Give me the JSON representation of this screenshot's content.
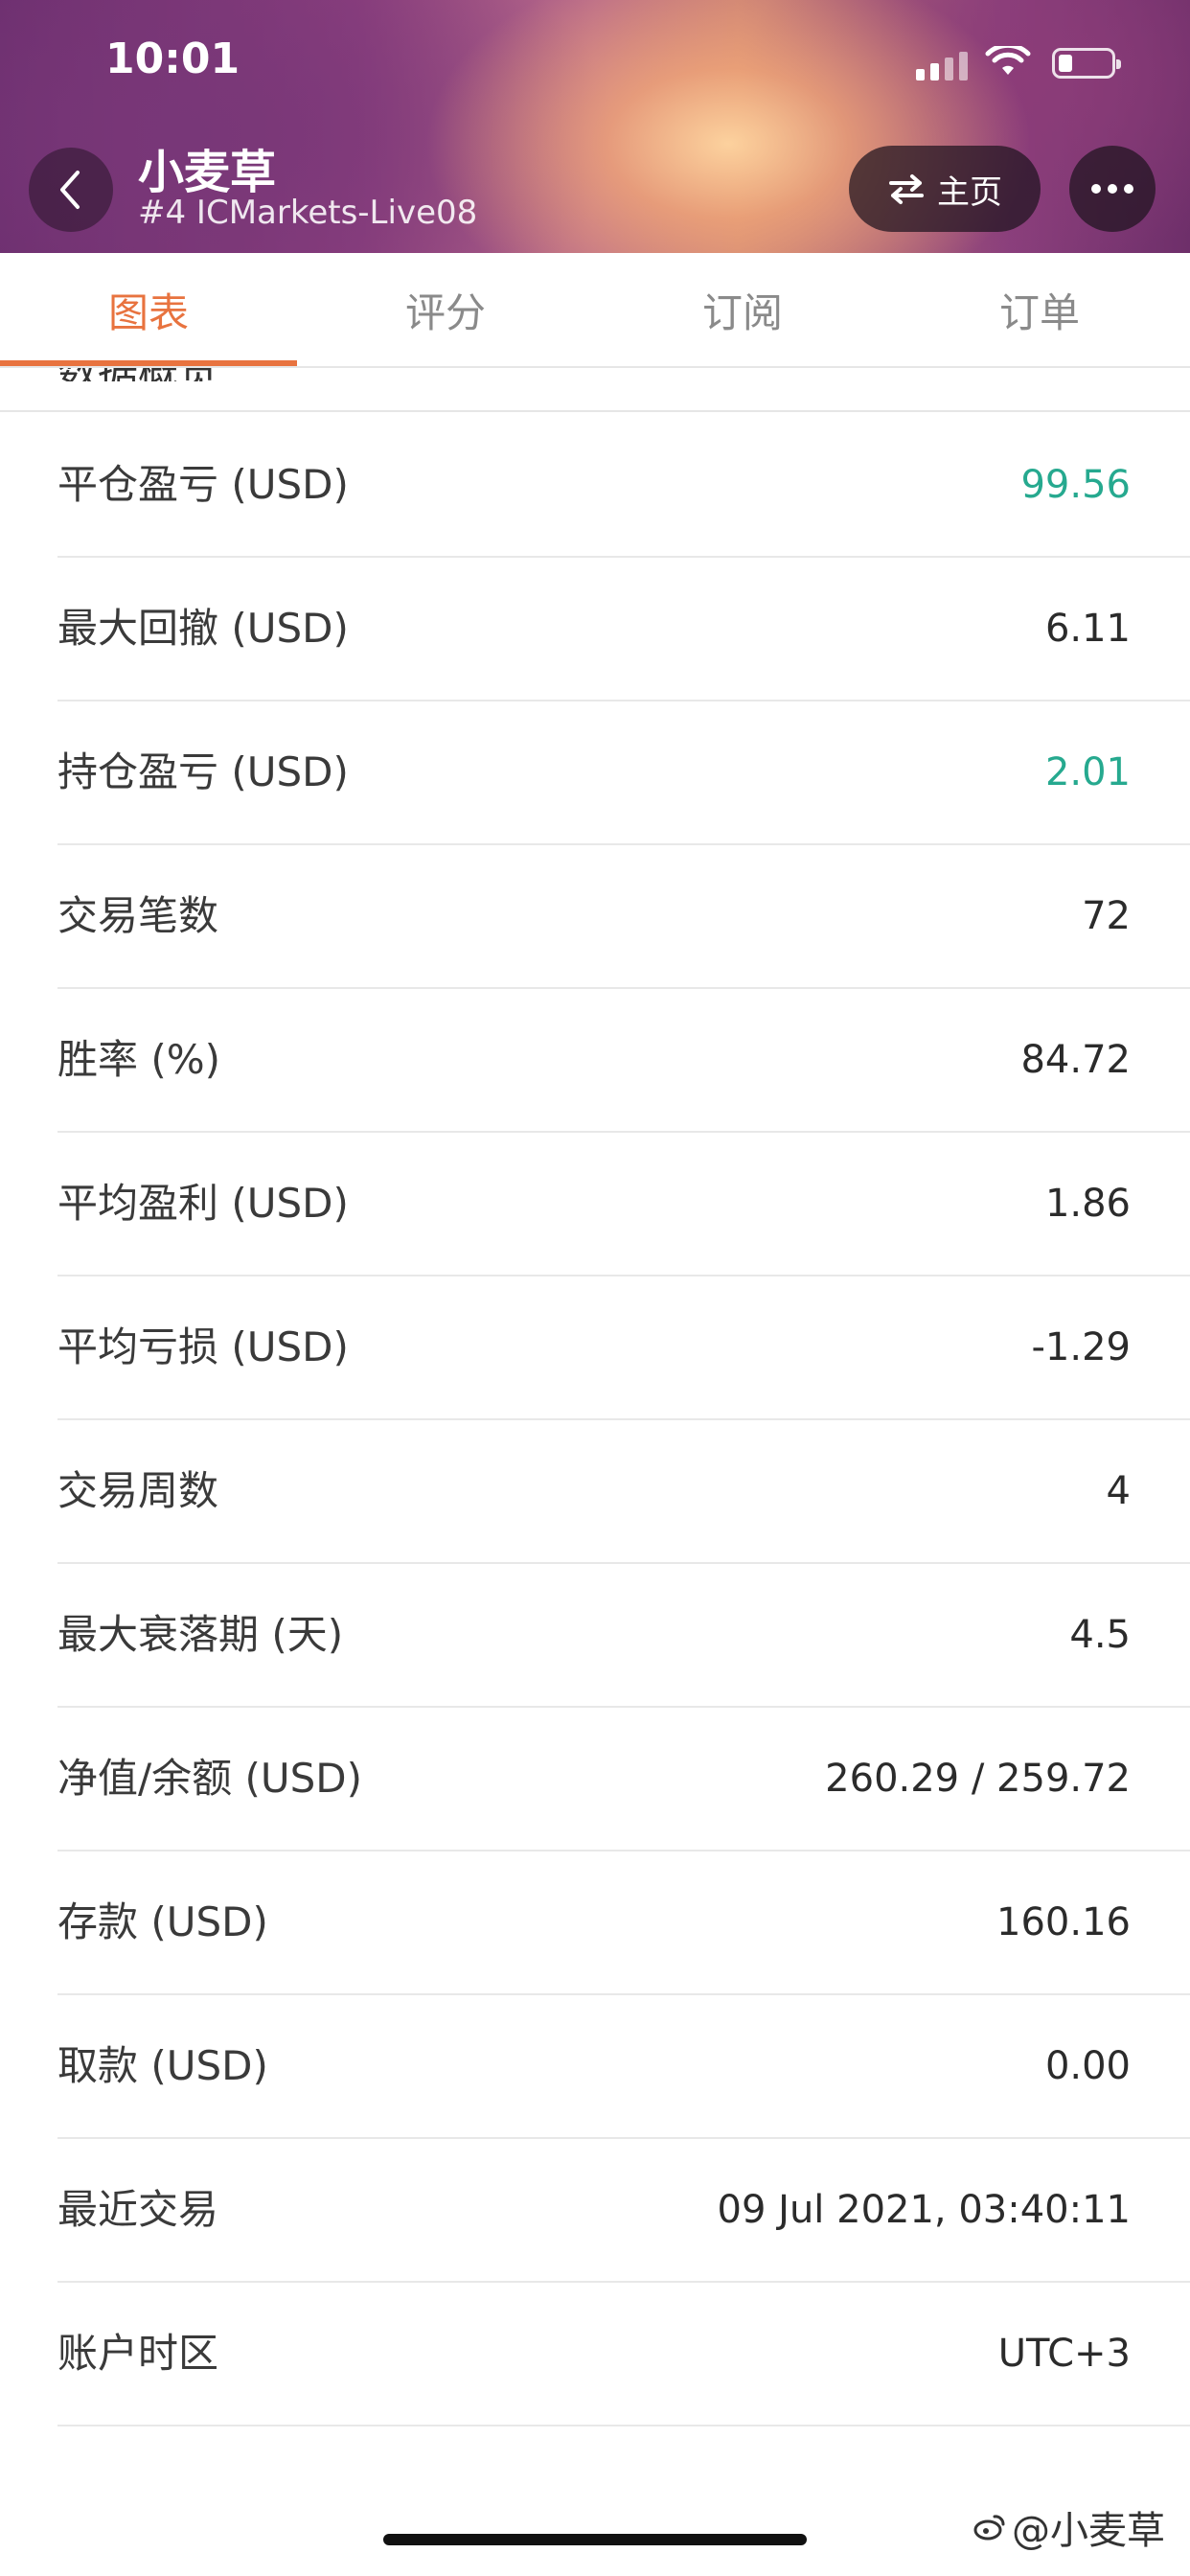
{
  "status_bar": {
    "time": "10:01"
  },
  "header": {
    "title": "小麦草",
    "subtitle": "#4 ICMarkets-Live08",
    "home_label": "主页"
  },
  "tabs": [
    {
      "label": "图表",
      "active": true
    },
    {
      "label": "评分",
      "active": false
    },
    {
      "label": "订阅",
      "active": false
    },
    {
      "label": "订单",
      "active": false
    }
  ],
  "section_title": "数据概览",
  "stats": [
    {
      "label": "平仓盈亏 (USD)",
      "value": "99.56",
      "color": "#26a98f"
    },
    {
      "label": "最大回撤 (USD)",
      "value": "6.11"
    },
    {
      "label": "持仓盈亏 (USD)",
      "value": "2.01",
      "color": "#26a98f"
    },
    {
      "label": "交易笔数",
      "value": "72"
    },
    {
      "label": "胜率 (%)",
      "value": "84.72"
    },
    {
      "label": "平均盈利 (USD)",
      "value": "1.86"
    },
    {
      "label": "平均亏损 (USD)",
      "value": "-1.29"
    },
    {
      "label": "交易周数",
      "value": "4"
    },
    {
      "label": "最大衰落期 (天)",
      "value": "4.5"
    },
    {
      "label": "净值/余额 (USD)",
      "value": "260.29 / 259.72"
    },
    {
      "label": "存款 (USD)",
      "value": "160.16"
    },
    {
      "label": "取款 (USD)",
      "value": "0.00"
    },
    {
      "label": "最近交易",
      "value": "09 Jul 2021, 03:40:11"
    },
    {
      "label": "账户时区",
      "value": "UTC+3"
    }
  ],
  "watermark": "@小麦草",
  "colors": {
    "accent": "#e8733f",
    "positive": "#26a98f"
  }
}
